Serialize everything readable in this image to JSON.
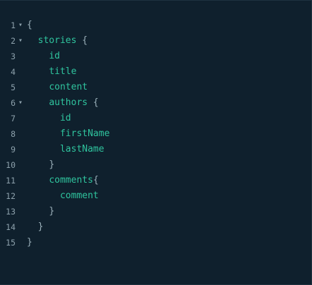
{
  "editor": {
    "lines": [
      {
        "num": "1",
        "fold": "▾",
        "indent": "",
        "field": "",
        "brace": "{"
      },
      {
        "num": "2",
        "fold": "▾",
        "indent": "  ",
        "field": "stories",
        "brace": " {"
      },
      {
        "num": "3",
        "fold": "",
        "indent": "    ",
        "field": "id",
        "brace": ""
      },
      {
        "num": "4",
        "fold": "",
        "indent": "    ",
        "field": "title",
        "brace": ""
      },
      {
        "num": "5",
        "fold": "",
        "indent": "    ",
        "field": "content",
        "brace": ""
      },
      {
        "num": "6",
        "fold": "▾",
        "indent": "    ",
        "field": "authors",
        "brace": " {"
      },
      {
        "num": "7",
        "fold": "",
        "indent": "      ",
        "field": "id",
        "brace": ""
      },
      {
        "num": "8",
        "fold": "",
        "indent": "      ",
        "field": "firstName",
        "brace": ""
      },
      {
        "num": "9",
        "fold": "",
        "indent": "      ",
        "field": "lastName",
        "brace": ""
      },
      {
        "num": "10",
        "fold": "",
        "indent": "    ",
        "field": "",
        "brace": "}"
      },
      {
        "num": "11",
        "fold": "",
        "indent": "    ",
        "field": "comments",
        "brace": "{"
      },
      {
        "num": "12",
        "fold": "",
        "indent": "      ",
        "field": "comment",
        "brace": ""
      },
      {
        "num": "13",
        "fold": "",
        "indent": "    ",
        "field": "",
        "brace": "}"
      },
      {
        "num": "14",
        "fold": "",
        "indent": "  ",
        "field": "",
        "brace": "}"
      },
      {
        "num": "15",
        "fold": "",
        "indent": "",
        "field": "",
        "brace": "}"
      }
    ]
  },
  "colors": {
    "background": "#0f202d",
    "field": "#2fc49e",
    "punctuation": "#9bb0ba",
    "gutter": "#8da1ac"
  }
}
